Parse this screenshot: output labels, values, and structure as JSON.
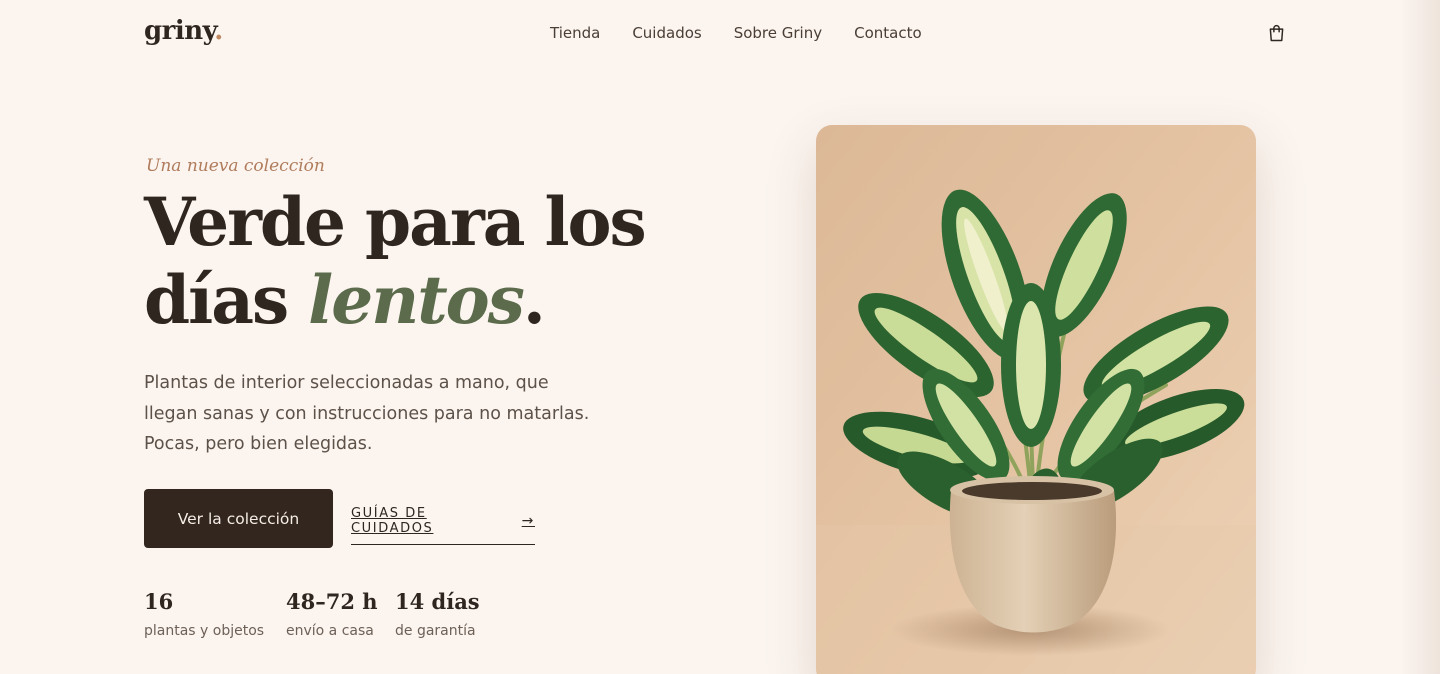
{
  "header": {
    "logo": "griny",
    "logo_dot": ".",
    "nav": [
      {
        "label": "Tienda"
      },
      {
        "label": "Cuidados"
      },
      {
        "label": "Sobre Griny"
      },
      {
        "label": "Contacto"
      }
    ],
    "cart_icon": "shopping-bag-icon"
  },
  "hero": {
    "eyebrow": "Una nueva colección",
    "headline_line1": "Verde para los",
    "headline_word": "días",
    "headline_accent": "lentos",
    "headline_period": ".",
    "lead": "Plantas de interior seleccionadas a mano, que llegan sanas y con instrucciones para no matarlas. Pocas, pero bien elegidas.",
    "primary_cta": "Ver la colección",
    "secondary_cta": "GUÍAS DE CUIDADOS",
    "secondary_icon": "arrow-right-icon",
    "stats": [
      {
        "value": "16",
        "label": "plantas y objetos"
      },
      {
        "value": "48–72 h",
        "label": "envío a casa"
      },
      {
        "value": "14 días",
        "label": "de garantía"
      }
    ]
  },
  "colors": {
    "background": "#fbf4ef",
    "text": "#2f2620",
    "accent_green": "#5b6b4b",
    "accent_terracotta": "#b07c5c",
    "button": "#32261f"
  }
}
